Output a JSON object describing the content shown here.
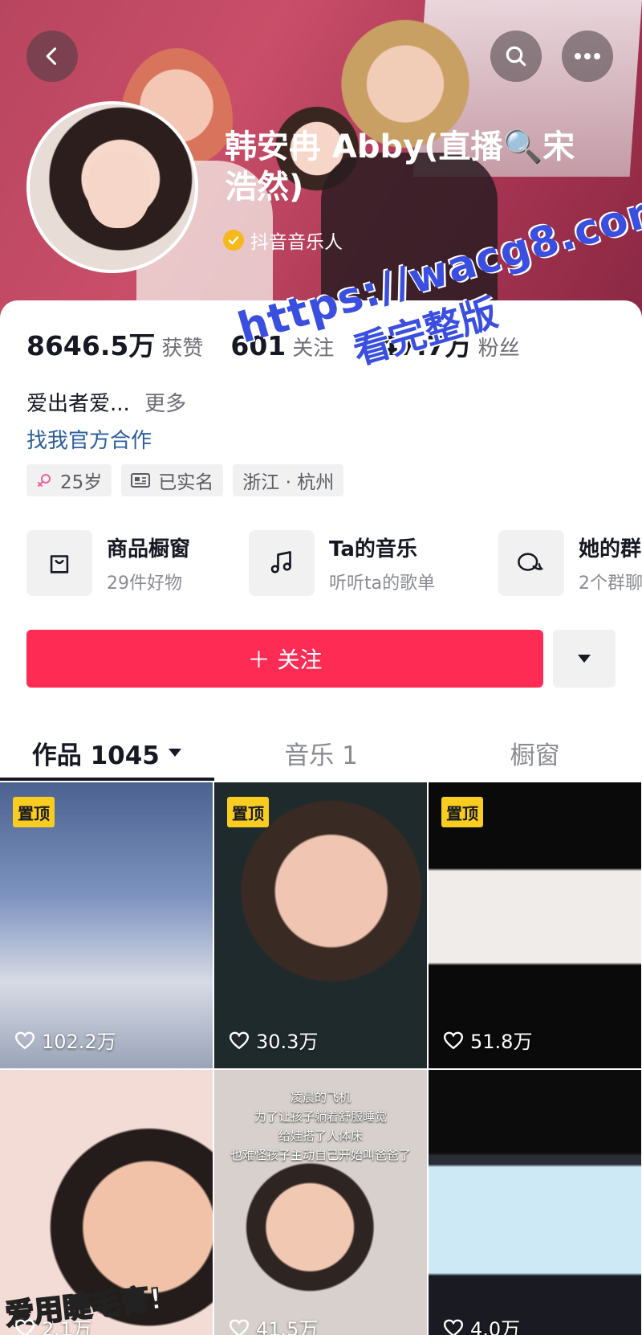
{
  "profile": {
    "name": "韩安冉 Abby(直播🔍宋浩然)",
    "verified_label": "抖音音乐人"
  },
  "stats": [
    {
      "value": "8646.5万",
      "label": "获赞"
    },
    {
      "value": "601",
      "label": "关注"
    },
    {
      "value": "347.7万",
      "label": "粉丝"
    }
  ],
  "bio": {
    "text": "爱出者爱...",
    "more_label": "更多",
    "cooperation_link": "找我官方合作"
  },
  "tags": [
    {
      "icon": "female-icon",
      "label": "25岁"
    },
    {
      "icon": "id-card-icon",
      "label": "已实名"
    },
    {
      "icon": "",
      "label": "浙江 · 杭州"
    }
  ],
  "services": [
    {
      "icon": "shopping-bag-icon",
      "title": "商品橱窗",
      "subtitle": "29件好物"
    },
    {
      "icon": "music-note-icon",
      "title": "Ta的音乐",
      "subtitle": "听听ta的歌单"
    },
    {
      "icon": "chat-bubbles-icon",
      "title": "她的群",
      "subtitle": "2个群聊"
    }
  ],
  "actions": {
    "follow_label": "＋ 关注"
  },
  "tabs": [
    {
      "label": "作品 1045",
      "active": true
    },
    {
      "label": "音乐 1",
      "active": false
    },
    {
      "label": "橱窗",
      "active": false
    }
  ],
  "videos": [
    {
      "pinned": true,
      "pin_label": "置顶",
      "likes": "102.2万"
    },
    {
      "pinned": true,
      "pin_label": "置顶",
      "likes": "30.3万"
    },
    {
      "pinned": true,
      "pin_label": "置顶",
      "likes": "51.8万"
    },
    {
      "pinned": false,
      "likes": "2.1万",
      "overlay_text": "爱用睫毛膏!"
    },
    {
      "pinned": false,
      "likes": "41.5万",
      "caption": [
        "凌晨的飞机",
        "为了让孩子躺着舒服睡觉",
        "给娃搭了人体床",
        "也难怪孩子主动自己开始叫爸爸了"
      ]
    },
    {
      "pinned": false,
      "likes": "4.0万"
    }
  ],
  "watermark": {
    "line1": "https://wacg8.com",
    "line2": "看完整版"
  },
  "colors": {
    "accent": "#fe2c55",
    "link": "#2c5e9c",
    "pin": "#f9cd1f",
    "header": "#b8455f"
  }
}
